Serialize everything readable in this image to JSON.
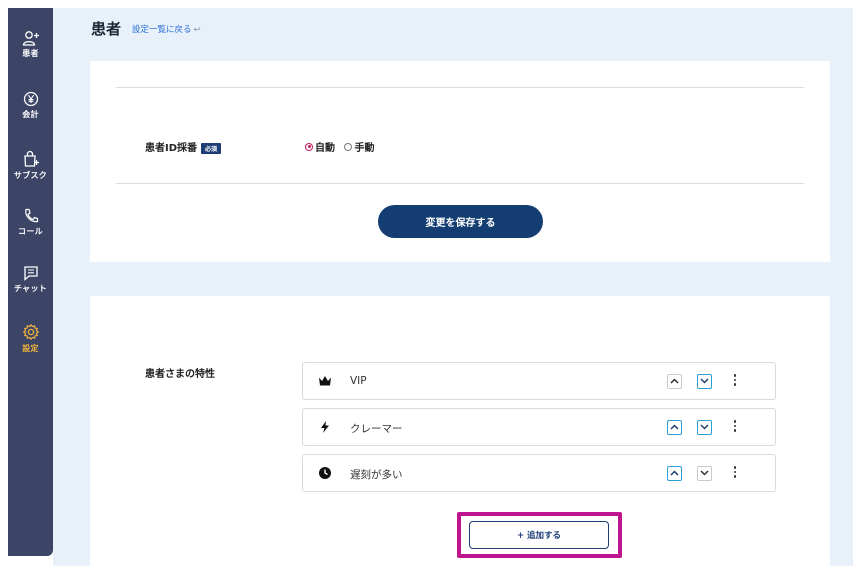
{
  "sidebar": {
    "items": [
      {
        "label": "患者",
        "icon": "user-plus-icon"
      },
      {
        "label": "会計",
        "icon": "yen-icon"
      },
      {
        "label": "サブスク",
        "icon": "shopping-bag-icon"
      },
      {
        "label": "コール",
        "icon": "phone-icon"
      },
      {
        "label": "チャット",
        "icon": "chat-icon"
      },
      {
        "label": "設定",
        "icon": "gear-icon",
        "active": true
      }
    ],
    "active_color": "#f0b43c",
    "background": "#3d4566"
  },
  "header": {
    "title": "患者",
    "back_link": "設定一覧に戻る",
    "back_icon": "return-arrow-icon"
  },
  "id_section": {
    "label": "患者ID採番",
    "required_badge": "必須",
    "options": [
      {
        "label": "自動",
        "selected": true
      },
      {
        "label": "手動",
        "selected": false
      }
    ],
    "save_label": "変更を保存する"
  },
  "attributes_section": {
    "label": "患者さまの特性",
    "items": [
      {
        "name": "VIP",
        "icon": "crown-icon"
      },
      {
        "name": "クレーマー",
        "icon": "lightning-icon"
      },
      {
        "name": "遅刻が多い",
        "icon": "clock-icon"
      }
    ],
    "add_label": "+ 追加する"
  },
  "colors": {
    "primary": "#143e72",
    "accent": "#2a9fd6",
    "highlight": "#c0158e",
    "radio_selected": "#c2185b",
    "page_bg": "#e8f1fa"
  }
}
